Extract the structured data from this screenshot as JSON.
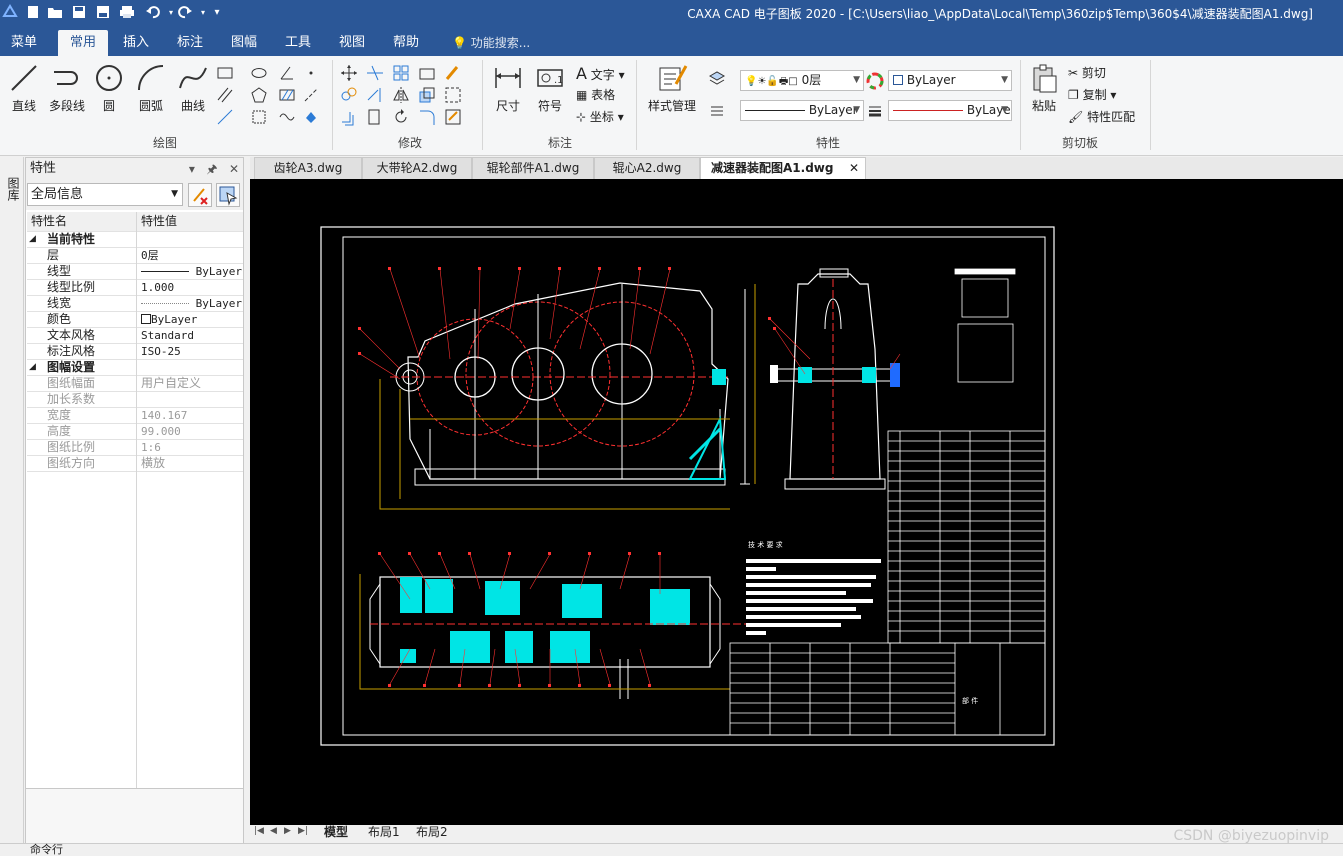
{
  "titlebar": {
    "title": "CAXA CAD 电子图板 2020 - [C:\\Users\\liao_\\AppData\\Local\\Temp\\360zip$Temp\\360$4\\减速器装配图A1.dwg]",
    "quick_access": [
      "new-icon",
      "open-icon",
      "save-icon",
      "save-as-icon",
      "print-icon",
      "undo-icon",
      "redo-icon",
      "customize-icon"
    ]
  },
  "ribbon_tabs": [
    {
      "label": "菜单",
      "active": false
    },
    {
      "label": "常用",
      "active": true
    },
    {
      "label": "插入",
      "active": false
    },
    {
      "label": "标注",
      "active": false
    },
    {
      "label": "图幅",
      "active": false
    },
    {
      "label": "工具",
      "active": false
    },
    {
      "label": "视图",
      "active": false
    },
    {
      "label": "帮助",
      "active": false
    }
  ],
  "search_placeholder": "功能搜索...",
  "ribbon": {
    "draw": {
      "line": "直线",
      "polyline": "多段线",
      "circle": "圆",
      "arc": "圆弧",
      "curve": "曲线",
      "group": "绘图"
    },
    "modify": {
      "group": "修改"
    },
    "annotate": {
      "dim": "尺寸",
      "symbol": "符号",
      "text": "文字",
      "table": "表格",
      "coord": "坐标",
      "group": "标注"
    },
    "props": {
      "style_mgr": "样式管理",
      "layer": "0层",
      "color": "ByLayer",
      "linetype": "ByLayer",
      "lineweight": "ByLayer",
      "group": "特性"
    },
    "clipboard": {
      "paste": "粘贴",
      "cut": "剪切",
      "copy": "复制",
      "match": "特性匹配",
      "group": "剪切板"
    }
  },
  "left_vtab": "图库",
  "panel": {
    "title": "特性",
    "selector": "全局信息",
    "col_name": "特性名",
    "col_value": "特性值",
    "groups": [
      {
        "label": "当前特性",
        "rows": [
          {
            "k": "层",
            "v": "0层"
          },
          {
            "k": "线型",
            "v": "ByLayer"
          },
          {
            "k": "线型比例",
            "v": "1.000"
          },
          {
            "k": "线宽",
            "v": "ByLayer"
          },
          {
            "k": "颜色",
            "v": "ByLayer"
          },
          {
            "k": "文本风格",
            "v": "Standard"
          },
          {
            "k": "标注风格",
            "v": "ISO-25"
          }
        ]
      },
      {
        "label": "图幅设置",
        "rows": [
          {
            "k": "图纸幅面",
            "v": "用户自定义"
          },
          {
            "k": "加长系数",
            "v": ""
          },
          {
            "k": "宽度",
            "v": "140.167"
          },
          {
            "k": "高度",
            "v": "99.000"
          },
          {
            "k": "图纸比例",
            "v": "1:6"
          },
          {
            "k": "图纸方向",
            "v": "横放"
          }
        ]
      }
    ]
  },
  "doc_tabs": [
    {
      "label": "齿轮A3.dwg",
      "active": false
    },
    {
      "label": "大带轮A2.dwg",
      "active": false
    },
    {
      "label": "辊轮部件A1.dwg",
      "active": false
    },
    {
      "label": "辊心A2.dwg",
      "active": false
    },
    {
      "label": "减速器装配图A1.dwg",
      "active": true
    }
  ],
  "drawing": {
    "tech_req_title": "技 术 要 求",
    "title_block_text": "部 件"
  },
  "layout_tabs": [
    {
      "label": "模型",
      "active": true
    },
    {
      "label": "布局1",
      "active": false
    },
    {
      "label": "布局2",
      "active": false
    }
  ],
  "command_line": "命令行",
  "watermark": "CSDN @biyezuopinvip",
  "colors": {
    "title_bar": "#2b5797",
    "canvas": "#000000",
    "drawing_white": "#ffffff",
    "drawing_red": "#ff3030",
    "drawing_cyan": "#00e5e5",
    "drawing_yellow": "#c8a000"
  }
}
